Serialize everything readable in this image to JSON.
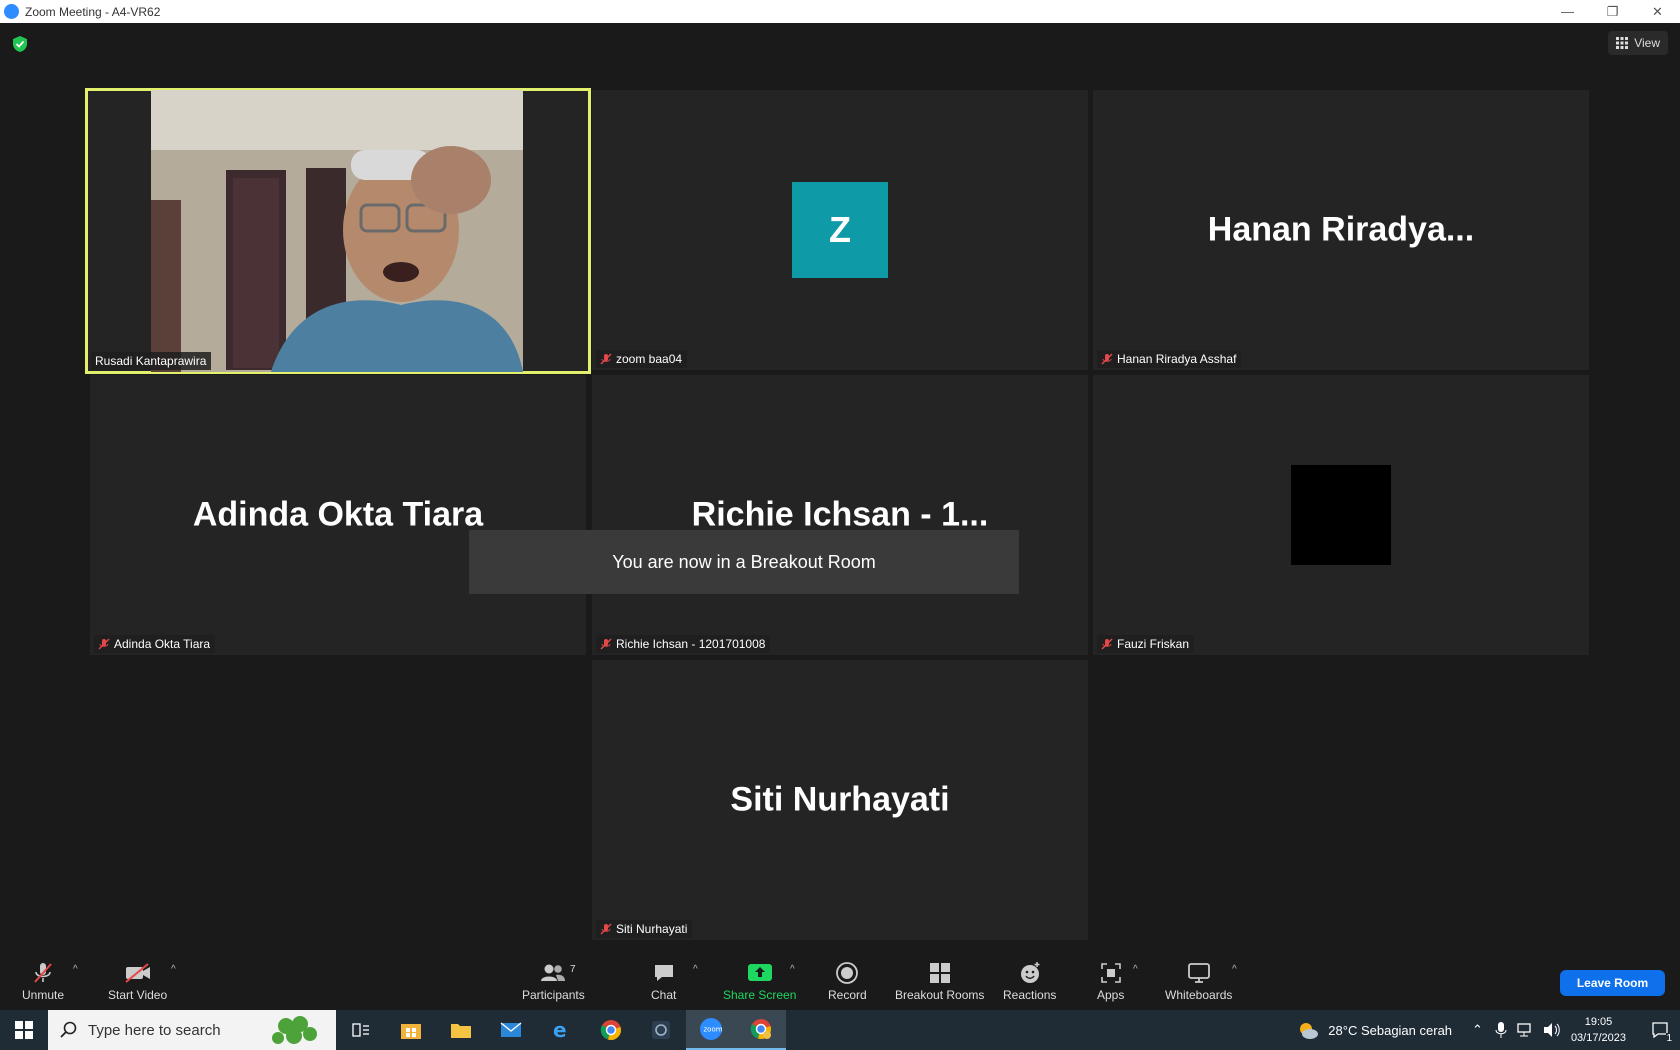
{
  "window": {
    "title": "Zoom Meeting - A4-VR62",
    "minimize": "—",
    "restore": "❐",
    "close": "✕"
  },
  "view_button": {
    "label": "View"
  },
  "toast": {
    "message": "You are now in a Breakout Room"
  },
  "participants": [
    {
      "tag": "Rusadi Kantaprawira",
      "big_name": "",
      "muted": false,
      "active_speaker": true
    },
    {
      "tag": "zoom baa04",
      "avatar_letter": "Z",
      "muted": true
    },
    {
      "tag": "Hanan Riradya Asshaf",
      "big_name": "Hanan  Riradya...",
      "muted": true
    },
    {
      "tag": "Adinda Okta Tiara",
      "big_name": "Adinda Okta Tiara",
      "muted": true
    },
    {
      "tag": "Richie Ichsan - 1201701008",
      "big_name": "Richie Ichsan  - 1...",
      "muted": true
    },
    {
      "tag": "Fauzi Friskan",
      "big_name": "",
      "muted": true
    },
    {
      "tag": "Siti Nurhayati",
      "big_name": "Siti Nurhayati",
      "muted": true
    }
  ],
  "toolbar": {
    "unmute": "Unmute",
    "start_video": "Start Video",
    "participants": "Participants",
    "participants_count": "7",
    "chat": "Chat",
    "share_screen": "Share Screen",
    "record": "Record",
    "breakout_rooms": "Breakout Rooms",
    "reactions": "Reactions",
    "apps": "Apps",
    "whiteboards": "Whiteboards",
    "leave": "Leave Room"
  },
  "taskbar": {
    "search_placeholder": "Type here to search",
    "weather": "28°C  Sebagian cerah",
    "time": "19:05",
    "date": "03/17/2023",
    "notification_count": "1"
  },
  "colors": {
    "active_border": "#e3f06b",
    "avatar_bg": "#0e9aa7",
    "leave_bg": "#0e71eb",
    "share_green": "#1ed760"
  }
}
